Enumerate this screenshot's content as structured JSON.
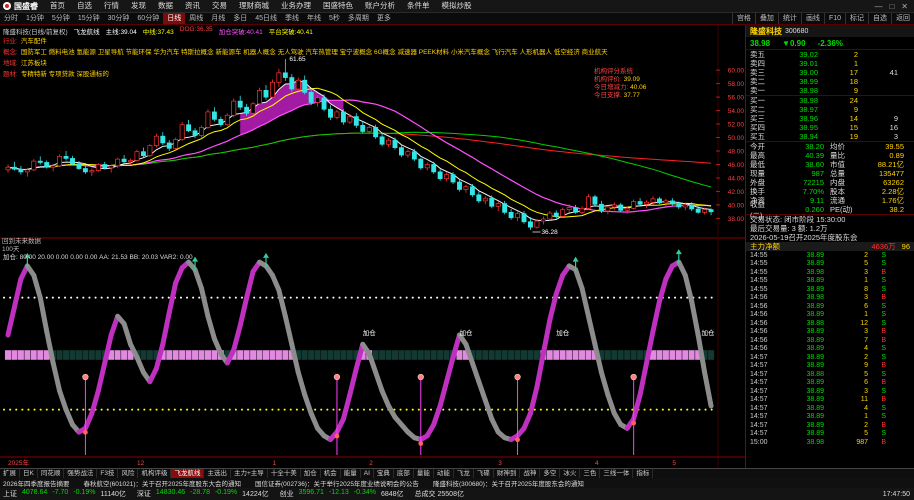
{
  "app": {
    "logo": "国盛睿"
  },
  "menu": [
    "首页",
    "自选",
    "行情",
    "发现",
    "数据",
    "资讯",
    "交易",
    "理财商城",
    "业务办理",
    "国盛特色",
    "账户分析",
    "条件单",
    "模拟炒股"
  ],
  "periods": [
    "分时",
    "1分钟",
    "5分钟",
    "15分钟",
    "30分钟",
    "60分钟",
    "日线",
    "周线",
    "月线",
    "多日",
    "45日线",
    "季线",
    "年线",
    "5秒",
    "多周期",
    "更多"
  ],
  "active_period": "日线",
  "tools": [
    "宫格",
    "叠加",
    "统计",
    "画线",
    "F10",
    "标记",
    "自选",
    "返回"
  ],
  "stock": {
    "name": "隆盛科技",
    "code": "300680",
    "price": "38.98",
    "change": "▼0.90",
    "pct": "-2.36%"
  },
  "orderbook": {
    "asks": [
      {
        "label": "卖五",
        "price": "39.02",
        "vol": "2",
        "extra": ""
      },
      {
        "label": "卖四",
        "price": "39.01",
        "vol": "1",
        "extra": ""
      },
      {
        "label": "卖三",
        "price": "39.00",
        "vol": "17",
        "extra": "41"
      },
      {
        "label": "卖二",
        "price": "38.99",
        "vol": "18",
        "extra": ""
      },
      {
        "label": "卖一",
        "price": "38.98",
        "vol": "9",
        "extra": ""
      }
    ],
    "bids": [
      {
        "label": "买一",
        "price": "38.98",
        "vol": "24",
        "extra": ""
      },
      {
        "label": "买二",
        "price": "38.97",
        "vol": "9",
        "extra": ""
      },
      {
        "label": "买三",
        "price": "38.96",
        "vol": "14",
        "extra": "9"
      },
      {
        "label": "买四",
        "price": "38.95",
        "vol": "15",
        "extra": "16"
      },
      {
        "label": "买五",
        "price": "38.94",
        "vol": "19",
        "extra": "3"
      }
    ]
  },
  "stats": [
    {
      "k": "今开",
      "v": "38.20",
      "k2": "均价",
      "v2": "39.55"
    },
    {
      "k": "最高",
      "v": "40.39",
      "k2": "量比",
      "v2": "0.89"
    },
    {
      "k": "最低",
      "v": "38.60",
      "k2": "市值",
      "v2": "88.21亿"
    },
    {
      "k": "现量",
      "v": "987",
      "k2": "总量",
      "v2": "135477"
    },
    {
      "k": "外盘",
      "v": "72215",
      "k2": "内盘",
      "v2": "63262"
    },
    {
      "k": "换手",
      "v": "7.70%",
      "k2": "股本",
      "v2": "2.28亿"
    },
    {
      "k": "净资",
      "v": "9.11",
      "k2": "流通",
      "v2": "1.76亿"
    },
    {
      "k": "收益(二)",
      "v": "0.260",
      "k2": "PE(动)",
      "v2": "38.2"
    }
  ],
  "status": [
    "交易状态: 闭市阶段 15:30:00",
    "最后交易量: 3  额: 1.2万",
    "2026-05-19召开2025年度股东会"
  ],
  "main_flow": {
    "label": "主力净额",
    "value": "4636万",
    "extra": "96"
  },
  "ticks": [
    [
      "14:55",
      "38.89",
      "2",
      "S"
    ],
    [
      "14:55",
      "38.89",
      "5",
      "S"
    ],
    [
      "14:55",
      "38.98",
      "3",
      "B"
    ],
    [
      "14:55",
      "38.89",
      "1",
      "S"
    ],
    [
      "14:55",
      "38.89",
      "8",
      "S"
    ],
    [
      "14:56",
      "38.98",
      "3",
      "B"
    ],
    [
      "14:56",
      "38.89",
      "6",
      "S"
    ],
    [
      "14:56",
      "38.89",
      "1",
      "S"
    ],
    [
      "14:56",
      "38.88",
      "12",
      "S"
    ],
    [
      "14:56",
      "38.89",
      "3",
      "B"
    ],
    [
      "14:56",
      "38.89",
      "7",
      "B"
    ],
    [
      "14:56",
      "38.89",
      "4",
      "S"
    ],
    [
      "14:57",
      "38.89",
      "2",
      "S"
    ],
    [
      "14:57",
      "38.89",
      "9",
      "B"
    ],
    [
      "14:57",
      "38.88",
      "5",
      "S"
    ],
    [
      "14:57",
      "38.89",
      "6",
      "B"
    ],
    [
      "14:57",
      "38.89",
      "3",
      "S"
    ],
    [
      "14:57",
      "38.89",
      "11",
      "B"
    ],
    [
      "14:57",
      "38.89",
      "4",
      "S"
    ],
    [
      "14:57",
      "38.89",
      "1",
      "S"
    ],
    [
      "14:57",
      "38.89",
      "2",
      "B"
    ],
    [
      "14:57",
      "38.89",
      "5",
      "S"
    ],
    [
      "15:00",
      "38.98",
      "987",
      "B"
    ]
  ],
  "chart_header": [
    {
      "text": "隆盛科技(日线/前复权)",
      "color": "#cccccc"
    },
    {
      "text": "飞龙航线",
      "color": "#ffffff"
    },
    {
      "text": "主线:39.04",
      "color": "#ffffff"
    },
    {
      "text": "中线:37.43",
      "color": "#ffff00"
    },
    {
      "text": "DOG:36.35",
      "color": "#ff4040"
    },
    {
      "text": "加仓突破:40.41",
      "color": "#ff4fff"
    },
    {
      "text": "平台突破:40.41",
      "color": "#ffff00"
    }
  ],
  "tags": [
    {
      "label": "行业:",
      "text": "汽车配件"
    },
    {
      "label": "概念:",
      "text": "国防军工 燃料电池 氢能源 卫星导航 节能环保 华为汽车 特斯拉概念 新能源车 机器人概念 无人驾驶 汽车热管理 宝宁波概念 6G概念 减速器 PEEK材料 小米汽车概念 飞行汽车 人形机器人 低空经济 商业航天"
    },
    {
      "label": "地域:",
      "text": "江苏板块"
    },
    {
      "label": "题材:",
      "text": "专精特新 专项贷款 深股通标的"
    }
  ],
  "institution": {
    "title": "机构评分系统",
    "rows": [
      {
        "k": "机构评价:",
        "v": "39.09"
      },
      {
        "k": "今日增减力:",
        "v": "40.06"
      },
      {
        "k": "今日支撑:",
        "v": "37.77"
      }
    ]
  },
  "future_note": [
    "回到未来数据",
    "100天"
  ],
  "sub_header": "加仓: 80.00  20.00  0.00  0.00  0.00  AA: 21.53  BB: 20.03  VAR2: 0.00",
  "colors": {
    "up": "#ff3232",
    "down": "#33e6e6",
    "fall_text": "#00dd00",
    "accent": "#8a0000"
  },
  "chart_data": {
    "type": "candlestick",
    "ylim": [
      36.28,
      61.65
    ],
    "y_ticks": [
      "38.00",
      "40.00",
      "42.00",
      "44.00",
      "46.00",
      "48.00",
      "50.00",
      "52.00",
      "54.00",
      "56.00",
      "58.00",
      "60.00"
    ],
    "high_label": "61.65",
    "low_label": "36.28",
    "date_labels": [
      {
        "i": 0,
        "text": "2025年"
      },
      {
        "i": 20,
        "text": "12"
      },
      {
        "i": 41,
        "text": "1"
      },
      {
        "i": 56,
        "text": "2"
      },
      {
        "i": 76,
        "text": "3"
      },
      {
        "i": 91,
        "text": "4"
      },
      {
        "i": 103,
        "text": "5"
      }
    ],
    "candles": [
      [
        45.2,
        46.0,
        44.8,
        45.6
      ],
      [
        45.6,
        46.4,
        45.1,
        45.3
      ],
      [
        45.3,
        45.8,
        44.5,
        44.9
      ],
      [
        44.9,
        45.5,
        44.2,
        45.2
      ],
      [
        45.2,
        46.8,
        45.0,
        46.5
      ],
      [
        46.5,
        47.2,
        46.0,
        46.3
      ],
      [
        46.3,
        46.6,
        45.4,
        45.6
      ],
      [
        45.6,
        46.1,
        45.0,
        45.8
      ],
      [
        45.8,
        47.5,
        45.6,
        47.2
      ],
      [
        47.2,
        48.0,
        46.6,
        46.9
      ],
      [
        46.9,
        47.3,
        45.9,
        46.1
      ],
      [
        46.1,
        46.5,
        45.2,
        45.4
      ],
      [
        45.4,
        45.9,
        44.6,
        44.9
      ],
      [
        44.9,
        45.4,
        44.3,
        45.1
      ],
      [
        45.1,
        46.2,
        44.9,
        46.0
      ],
      [
        46.0,
        46.4,
        45.3,
        45.5
      ],
      [
        45.5,
        46.0,
        44.8,
        45.8
      ],
      [
        45.8,
        47.0,
        45.5,
        46.8
      ],
      [
        46.8,
        47.4,
        46.2,
        46.4
      ],
      [
        46.4,
        46.9,
        45.9,
        46.6
      ],
      [
        46.6,
        48.2,
        46.4,
        47.9
      ],
      [
        47.9,
        48.5,
        47.0,
        47.3
      ],
      [
        47.3,
        49.0,
        47.1,
        48.8
      ],
      [
        48.8,
        50.6,
        48.5,
        50.2
      ],
      [
        50.2,
        50.8,
        48.9,
        49.2
      ],
      [
        49.2,
        49.6,
        48.0,
        48.4
      ],
      [
        48.4,
        50.0,
        48.2,
        49.7
      ],
      [
        49.7,
        52.3,
        49.5,
        51.9
      ],
      [
        51.9,
        52.6,
        50.8,
        51.0
      ],
      [
        51.0,
        51.4,
        49.9,
        50.3
      ],
      [
        50.3,
        51.8,
        50.0,
        51.5
      ],
      [
        51.5,
        54.2,
        51.3,
        53.8
      ],
      [
        53.8,
        54.5,
        52.4,
        52.7
      ],
      [
        52.7,
        53.1,
        51.6,
        51.9
      ],
      [
        51.9,
        53.6,
        51.7,
        53.3
      ],
      [
        53.3,
        55.8,
        53.0,
        55.4
      ],
      [
        55.4,
        56.2,
        54.1,
        54.5
      ],
      [
        54.5,
        55.0,
        53.2,
        53.6
      ],
      [
        53.6,
        55.3,
        53.4,
        55.0
      ],
      [
        55.0,
        57.4,
        54.8,
        57.0
      ],
      [
        57.0,
        57.8,
        55.6,
        56.0
      ],
      [
        56.0,
        58.6,
        55.8,
        58.2
      ],
      [
        58.2,
        60.2,
        57.5,
        59.6
      ],
      [
        59.6,
        61.65,
        58.4,
        58.9
      ],
      [
        58.9,
        59.4,
        56.8,
        57.2
      ],
      [
        57.2,
        58.9,
        56.9,
        58.5
      ],
      [
        58.5,
        59.2,
        56.4,
        56.7
      ],
      [
        56.7,
        57.1,
        54.8,
        55.2
      ],
      [
        55.2,
        56.3,
        54.6,
        55.9
      ],
      [
        55.9,
        56.4,
        53.9,
        54.2
      ],
      [
        54.2,
        54.8,
        52.6,
        53.0
      ],
      [
        53.0,
        54.1,
        52.7,
        53.8
      ],
      [
        53.8,
        54.2,
        51.9,
        52.3
      ],
      [
        52.3,
        53.5,
        52.0,
        53.1
      ],
      [
        53.1,
        53.6,
        51.4,
        51.8
      ],
      [
        51.8,
        52.4,
        50.6,
        50.9
      ],
      [
        50.9,
        51.8,
        50.5,
        51.5
      ],
      [
        51.5,
        51.9,
        49.8,
        50.1
      ],
      [
        50.1,
        50.6,
        48.7,
        49.0
      ],
      [
        49.0,
        49.9,
        48.6,
        49.6
      ],
      [
        49.6,
        50.0,
        48.2,
        48.5
      ],
      [
        48.5,
        48.9,
        47.1,
        47.4
      ],
      [
        47.4,
        48.2,
        47.0,
        47.9
      ],
      [
        47.9,
        48.3,
        46.5,
        46.8
      ],
      [
        46.8,
        47.0,
        45.2,
        45.5
      ],
      [
        45.5,
        46.3,
        45.1,
        46.0
      ],
      [
        46.0,
        46.4,
        44.6,
        44.9
      ],
      [
        44.9,
        45.3,
        43.6,
        43.9
      ],
      [
        43.9,
        44.8,
        43.5,
        44.5
      ],
      [
        44.5,
        44.9,
        43.1,
        43.4
      ],
      [
        43.4,
        43.8,
        42.0,
        42.3
      ],
      [
        42.3,
        43.0,
        41.8,
        42.7
      ],
      [
        42.7,
        43.1,
        41.2,
        41.5
      ],
      [
        41.5,
        42.0,
        40.3,
        40.6
      ],
      [
        40.6,
        41.3,
        40.1,
        41.0
      ],
      [
        41.0,
        41.4,
        39.5,
        39.8
      ],
      [
        39.8,
        40.5,
        39.1,
        40.2
      ],
      [
        40.2,
        40.6,
        38.6,
        38.9
      ],
      [
        38.9,
        39.4,
        37.8,
        38.1
      ],
      [
        38.1,
        39.0,
        37.6,
        38.7
      ],
      [
        38.7,
        39.1,
        37.2,
        37.5
      ],
      [
        37.5,
        38.2,
        36.28,
        36.7
      ],
      [
        36.7,
        37.9,
        36.5,
        37.6
      ],
      [
        37.6,
        38.3,
        37.1,
        37.9
      ],
      [
        37.9,
        39.1,
        37.7,
        38.8
      ],
      [
        38.8,
        39.2,
        38.0,
        38.3
      ],
      [
        38.3,
        39.6,
        38.1,
        39.3
      ],
      [
        39.3,
        40.1,
        38.9,
        39.6
      ],
      [
        39.6,
        40.0,
        38.7,
        38.9
      ],
      [
        38.9,
        39.8,
        38.6,
        39.5
      ],
      [
        39.5,
        41.6,
        39.3,
        41.2
      ],
      [
        41.2,
        41.5,
        39.9,
        40.1
      ],
      [
        40.1,
        40.6,
        38.8,
        39.1
      ],
      [
        39.1,
        39.9,
        38.6,
        39.7
      ],
      [
        39.7,
        40.4,
        39.2,
        40.0
      ],
      [
        40.0,
        40.3,
        38.9,
        39.2
      ],
      [
        39.2,
        39.8,
        38.7,
        39.5
      ],
      [
        39.5,
        40.8,
        39.3,
        40.5
      ],
      [
        40.5,
        41.0,
        39.8,
        40.1
      ],
      [
        40.1,
        40.7,
        39.5,
        40.4
      ],
      [
        40.4,
        41.3,
        40.0,
        40.9
      ],
      [
        40.9,
        41.2,
        40.1,
        40.3
      ],
      [
        40.3,
        40.9,
        39.8,
        40.6
      ],
      [
        40.6,
        41.0,
        39.9,
        40.2
      ],
      [
        40.2,
        40.5,
        39.4,
        39.7
      ],
      [
        39.7,
        40.3,
        39.2,
        40.0
      ],
      [
        40.0,
        40.4,
        39.1,
        39.4
      ],
      [
        39.4,
        39.9,
        38.7,
        38.9
      ],
      [
        38.9,
        39.6,
        38.6,
        39.3
      ],
      [
        39.3,
        39.5,
        38.5,
        38.98
      ]
    ],
    "oscillator": {
      "ref_lines": [
        80,
        20
      ],
      "values": [
        60,
        75,
        90,
        97,
        92,
        80,
        62,
        45,
        30,
        20,
        12,
        8,
        10,
        18,
        30,
        45,
        60,
        70,
        66,
        55,
        48,
        40,
        35,
        42,
        55,
        72,
        88,
        96,
        99,
        95,
        85,
        70,
        58,
        50,
        45,
        52,
        65,
        80,
        94,
        99,
        97,
        92,
        84,
        70,
        55,
        40,
        28,
        18,
        10,
        6,
        4,
        8,
        15,
        28,
        42,
        55,
        50,
        40,
        30,
        22,
        16,
        12,
        8,
        5,
        4,
        6,
        12,
        22,
        35,
        48,
        60,
        55,
        45,
        35,
        25,
        15,
        8,
        5,
        4,
        6,
        10,
        18,
        32,
        50,
        68,
        82,
        92,
        97,
        95,
        85,
        70,
        55,
        40,
        28,
        18,
        12,
        10,
        15,
        28,
        45,
        62,
        78,
        90,
        97,
        99,
        92,
        78,
        60,
        40,
        22
      ],
      "top_marks": [
        3,
        29,
        40,
        88,
        104
      ],
      "bottom_marks": [
        12,
        51,
        64,
        79,
        97
      ],
      "signals": [
        {
          "i": 56,
          "label": "加仓"
        },
        {
          "i": 71,
          "label": "加仓"
        },
        {
          "i": 86,
          "label": "加仓"
        },
        {
          "i": 109,
          "label": "加仓"
        }
      ]
    }
  },
  "tabs": [
    "扩展",
    "日K",
    "同花顺",
    "强势战法",
    "F3技",
    "风险",
    "机构评级",
    "飞龙航线",
    "主选出",
    "主力+主导",
    "十全十美",
    "加仓",
    "机会",
    "能量",
    "AI",
    "宝典",
    "底部",
    "量能",
    "动能",
    "飞龙",
    "飞碟",
    "财神到",
    "战神",
    "多空",
    "冰火",
    "三色",
    "三线一体",
    "指标"
  ],
  "active_tab": "飞龙航线",
  "news": [
    "2026年四季度报告摘要",
    "春秋航空(601021)：关于召开2025年度股东大会的通知",
    "国信证券(002736)：关于举行2025年度业绩说明会的公告",
    "隆盛科技(300680)：关于召开2025年度股东会的通知"
  ],
  "index": [
    {
      "name": "上证",
      "value": "4078.64",
      "chg": "-7.70",
      "pct": "-0.19%",
      "amt": "11140亿"
    },
    {
      "name": "深证",
      "value": "14830.46",
      "chg": "-28.78",
      "pct": "-0.19%",
      "amt": "14224亿"
    },
    {
      "name": "创业",
      "value": "3596.71",
      "chg": "-12.13",
      "pct": "-0.34%",
      "amt": "6848亿"
    }
  ],
  "total_turnover": "总成交 25508亿",
  "clock": "17:47:50"
}
